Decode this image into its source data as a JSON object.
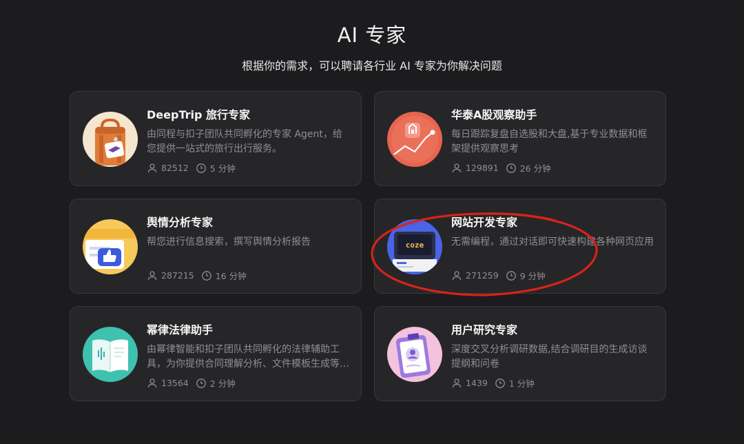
{
  "page": {
    "title": "AI 专家",
    "subtitle": "根据你的需求，可以聘请各行业 AI 专家为你解决问题"
  },
  "colors": {
    "background": "#1c1c1e",
    "card": "#262628",
    "card_border": "#38383b",
    "muted_text": "#8f8f94",
    "annotation": "#d8231b"
  },
  "experts": [
    {
      "title": "DeepTrip 旅行专家",
      "description": "由同程与扣子团队共同孵化的专家 Agent，给您提供一站式的旅行出行服务。",
      "users": "82512",
      "duration": "5 分钟",
      "icon": "suitcase-icon"
    },
    {
      "title": "华泰A股观察助手",
      "description": "每日跟踪复盘自选股和大盘,基于专业数据和框架提供观察思考",
      "users": "129891",
      "duration": "26 分钟",
      "icon": "stock-chart-icon"
    },
    {
      "title": "舆情分析专家",
      "description": "帮您进行信息搜索，撰写舆情分析报告",
      "users": "287215",
      "duration": "16 分钟",
      "icon": "thumbs-up-icon"
    },
    {
      "title": "网站开发专家",
      "description": "无需编程，通过对话即可快速构建各种网页应用",
      "users": "271259",
      "duration": "9 分钟",
      "icon": "coze-computer-icon",
      "icon_text": "coze"
    },
    {
      "title": "幂律法律助手",
      "description": "由幂律智能和扣子团队共同孵化的法律辅助工具，为你提供合同理解分析、文件模板生成等服务",
      "users": "13564",
      "duration": "2 分钟",
      "icon": "law-book-icon"
    },
    {
      "title": "用户研究专家",
      "description": "深度交叉分析调研数据,结合调研目的生成访谈提纲和问卷",
      "users": "1439",
      "duration": "1 分钟",
      "icon": "clipboard-user-icon"
    }
  ]
}
